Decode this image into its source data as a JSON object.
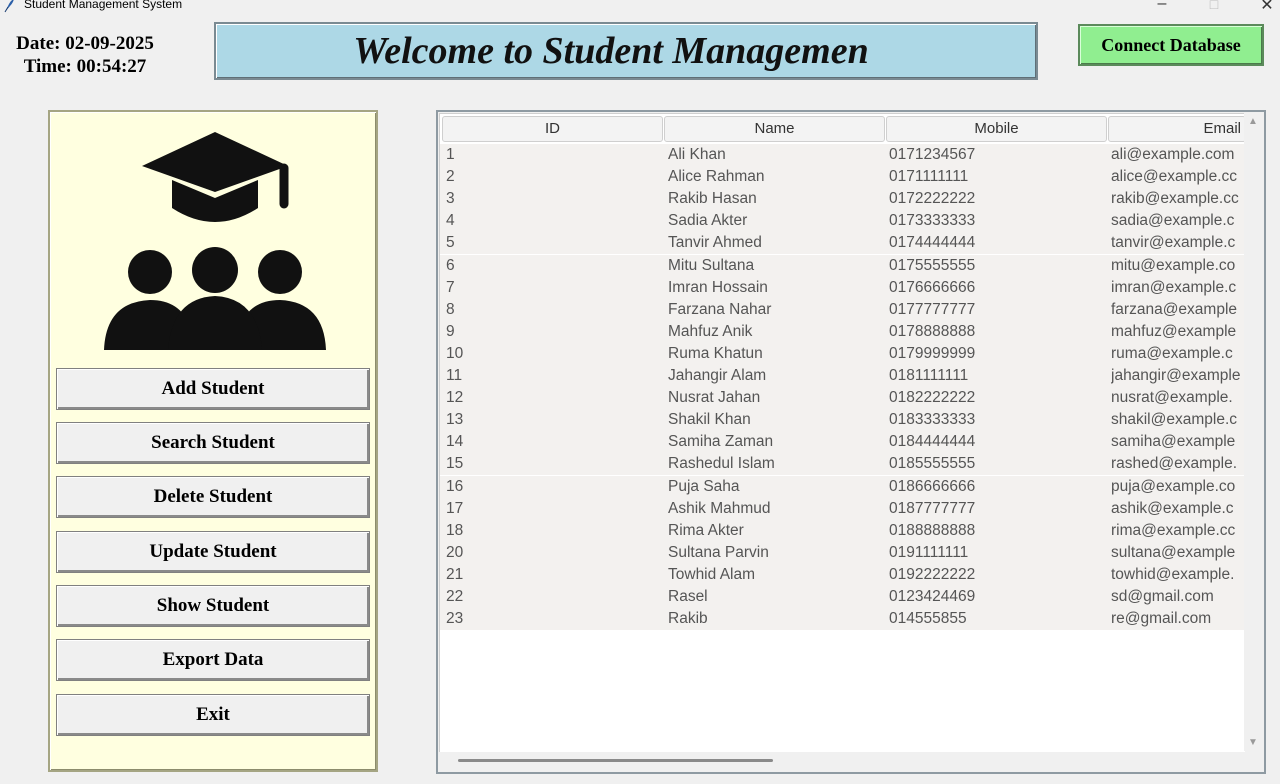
{
  "window": {
    "title": "Student Management System",
    "controls": {
      "minimize": "–",
      "maximize": "□",
      "close": "✕"
    }
  },
  "header": {
    "date_text": "Date: 02-09-2025",
    "time_text": "Time: 00:54:27",
    "banner_text": "Welcome to Student Managemen",
    "connect_label": "Connect Database"
  },
  "sidebar": {
    "logo_icon": "graduation-students-icon",
    "buttons": [
      {
        "label": "Add Student"
      },
      {
        "label": "Search Student"
      },
      {
        "label": "Delete Student"
      },
      {
        "label": "Update Student"
      },
      {
        "label": "Show Student"
      },
      {
        "label": "Export Data"
      },
      {
        "label": "Exit"
      }
    ]
  },
  "table": {
    "columns": [
      "ID",
      "Name",
      "Mobile",
      "Email"
    ],
    "rows": [
      [
        "1",
        "Ali Khan",
        "0171234567",
        "ali@example.com"
      ],
      [
        "2",
        "Alice Rahman",
        "0171111111",
        "alice@example.cc"
      ],
      [
        "3",
        "Rakib Hasan",
        "0172222222",
        "rakib@example.cc"
      ],
      [
        "4",
        "Sadia Akter",
        "0173333333",
        "sadia@example.c"
      ],
      [
        "5",
        "Tanvir Ahmed",
        "0174444444",
        "tanvir@example.c"
      ],
      [
        "6",
        "Mitu Sultana",
        "0175555555",
        "mitu@example.co"
      ],
      [
        "7",
        "Imran Hossain",
        "0176666666",
        "imran@example.c"
      ],
      [
        "8",
        "Farzana Nahar",
        "0177777777",
        "farzana@example"
      ],
      [
        "9",
        "Mahfuz Anik",
        "0178888888",
        "mahfuz@example"
      ],
      [
        "10",
        "Ruma Khatun",
        "0179999999",
        "ruma@example.c"
      ],
      [
        "11",
        "Jahangir Alam",
        "0181111111",
        "jahangir@example"
      ],
      [
        "12",
        "Nusrat Jahan",
        "0182222222",
        "nusrat@example."
      ],
      [
        "13",
        "Shakil Khan",
        "0183333333",
        "shakil@example.c"
      ],
      [
        "14",
        "Samiha Zaman",
        "0184444444",
        "samiha@example"
      ],
      [
        "15",
        "Rashedul Islam",
        "0185555555",
        "rashed@example."
      ],
      [
        "16",
        "Puja Saha",
        "0186666666",
        "puja@example.co"
      ],
      [
        "17",
        "Ashik Mahmud",
        "0187777777",
        "ashik@example.c"
      ],
      [
        "18",
        "Rima Akter",
        "0188888888",
        "rima@example.cc"
      ],
      [
        "20",
        "Sultana Parvin",
        "0191111111",
        "sultana@example"
      ],
      [
        "21",
        "Towhid Alam",
        "0192222222",
        "towhid@example."
      ],
      [
        "22",
        "Rasel",
        "0123424469",
        "sd@gmail.com"
      ],
      [
        "23",
        "Rakib",
        "014555855",
        "re@gmail.com"
      ]
    ]
  },
  "colors": {
    "banner": "#add8e6",
    "connect_button": "#90ee90",
    "sidebar_panel": "#ffffe0",
    "row_background": "#f3f1ef"
  }
}
